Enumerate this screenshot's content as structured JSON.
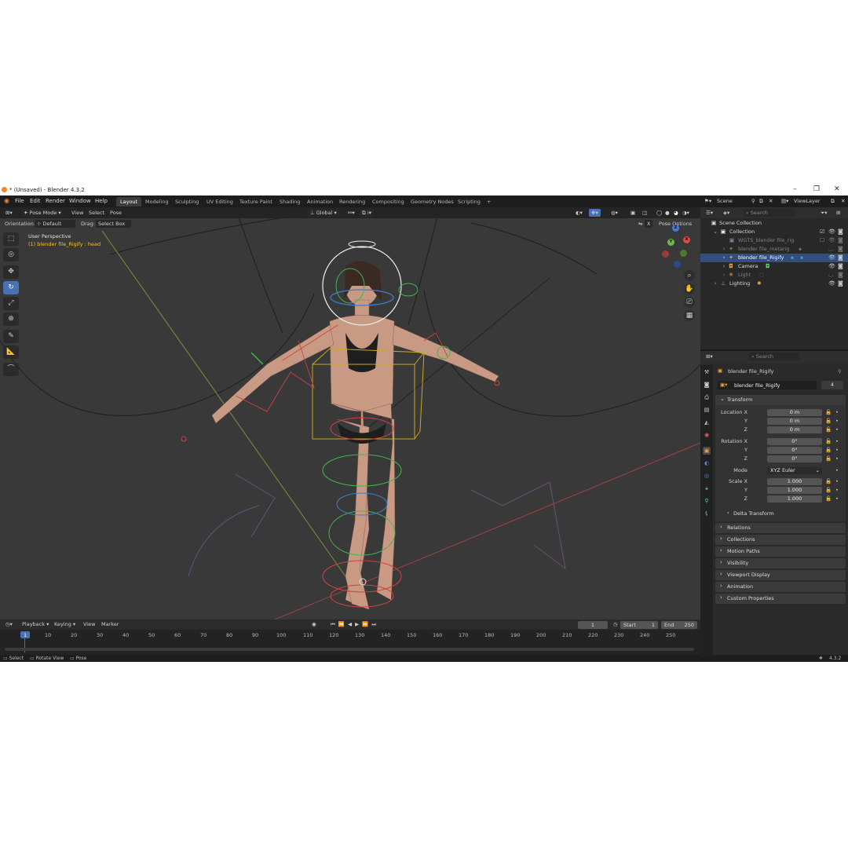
{
  "window": {
    "title": "* (Unsaved) - Blender 4.3.2",
    "min": "–",
    "max": "❐",
    "close": "✕"
  },
  "menu": [
    "File",
    "Edit",
    "Render",
    "Window",
    "Help"
  ],
  "workspaces": [
    "Layout",
    "Modeling",
    "Sculpting",
    "UV Editing",
    "Texture Paint",
    "Shading",
    "Animation",
    "Rendering",
    "Compositing",
    "Geometry Nodes",
    "Scripting"
  ],
  "workspace_add": "+",
  "viewport_header": {
    "mode": "Pose Mode",
    "menus": [
      "View",
      "Select",
      "Pose"
    ],
    "transform": "Global",
    "orientation_label": "Orientation:",
    "orientation_value": "Default",
    "drag_label": "Drag:",
    "drag_value": "Select Box",
    "pose_options": "Pose Options",
    "x_mirror": "X"
  },
  "viewport_overlay": {
    "perspective": "User Perspective",
    "active": "(1) blender file_Rigify : head"
  },
  "gizmo": {
    "x": "X",
    "y": "Y",
    "z": "Z"
  },
  "timeline": {
    "menus": [
      "Playback",
      "Keying",
      "View",
      "Marker"
    ],
    "current_frame": "1",
    "start_label": "Start",
    "start": "1",
    "end_label": "End",
    "end": "250",
    "ticks": [
      "1",
      "10",
      "20",
      "30",
      "40",
      "50",
      "60",
      "70",
      "80",
      "90",
      "100",
      "110",
      "120",
      "130",
      "140",
      "150",
      "160",
      "170",
      "180",
      "190",
      "200",
      "210",
      "220",
      "230",
      "240",
      "250"
    ]
  },
  "status": {
    "select": "Select",
    "rotate": "Rotate View",
    "pose": "Pose",
    "version": "4.3.2"
  },
  "right_header": {
    "scene": "Scene",
    "view_layer": "ViewLayer"
  },
  "outliner": {
    "search_placeholder": "Search",
    "rows": [
      {
        "label": "Scene Collection",
        "dim": false,
        "selected": false
      },
      {
        "label": "Collection",
        "dim": false,
        "selected": false
      },
      {
        "label": "WGTS_blender file_rig",
        "dim": true,
        "selected": false
      },
      {
        "label": "blender file_metarig",
        "dim": true,
        "selected": false
      },
      {
        "label": "blender file_Rigify",
        "dim": false,
        "selected": true
      },
      {
        "label": "Camera",
        "dim": false,
        "selected": false
      },
      {
        "label": "Light",
        "dim": true,
        "selected": false
      },
      {
        "label": "Lighting",
        "dim": false,
        "selected": false
      }
    ]
  },
  "properties": {
    "search_placeholder": "Search",
    "object_name": "blender file_Rigify",
    "datablock_name": "blender file_Rigify",
    "users": "4",
    "transform_header": "Transform",
    "location": {
      "label": "Location X",
      "y": "Y",
      "z": "Z",
      "values": [
        "0 m",
        "0 m",
        "0 m"
      ]
    },
    "rotation": {
      "label": "Rotation X",
      "y": "Y",
      "z": "Z",
      "values": [
        "0°",
        "0°",
        "0°"
      ]
    },
    "mode_label": "Mode",
    "mode_value": "XYZ Euler",
    "scale": {
      "label": "Scale X",
      "y": "Y",
      "z": "Z",
      "values": [
        "1.000",
        "1.000",
        "1.000"
      ]
    },
    "delta": "Delta Transform",
    "sections": [
      "Relations",
      "Collections",
      "Motion Paths",
      "Visibility",
      "Viewport Display",
      "Animation",
      "Custom Properties"
    ]
  },
  "colors": {
    "accent": "#4772b3",
    "selected_row": "#334d80",
    "bg_viewport": "#3a3a3a",
    "header": "#1d1d1d"
  }
}
